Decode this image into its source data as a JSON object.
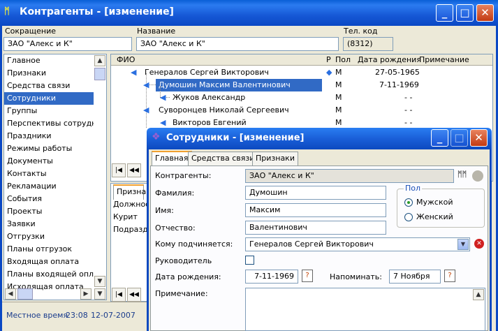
{
  "window": {
    "title": "Контрагенты - [изменение]"
  },
  "header": {
    "short_label": "Сокращение",
    "short_value": "ЗАО \"Алекс и К\"",
    "name_label": "Название",
    "name_value": "ЗАО \"Алекс и К\"",
    "phone_label": "Тел. код",
    "phone_value": "(8312)"
  },
  "sidebar": {
    "items": [
      "Главное",
      "Признаки",
      "Средства связи",
      "Сотрудники",
      "Группы",
      "Перспективы сотрудничества",
      "Праздники",
      "Режимы работы",
      "Документы",
      "Контакты",
      "Рекламации",
      "События",
      "Проекты",
      "Заявки",
      "Отгрузки",
      "Планы отгрузок",
      "Входящая оплата",
      "Планы входящей оплаты",
      "Исходящая оплата"
    ],
    "selected": "Сотрудники"
  },
  "grid": {
    "columns": {
      "fio": "ФИО",
      "flag": "Р",
      "gender": "Пол",
      "birth": "Дата рождения",
      "note": "Примечание"
    },
    "rows": [
      {
        "name": "Генералов Сергей Викторович",
        "gender": "М",
        "birth": "27-05-1965"
      },
      {
        "name": "Думошин Максим Валентинович",
        "gender": "М",
        "birth": "7-11-1969"
      },
      {
        "name": "Жуков Александр",
        "gender": "М",
        "birth": "- -"
      },
      {
        "name": "Суворонцев Николай Сергеевич",
        "gender": "М",
        "birth": "- -"
      },
      {
        "name": "Викторов Евгений",
        "gender": "М",
        "birth": "- -"
      }
    ]
  },
  "lower": {
    "tab": "Призна",
    "rows": [
      "Должност",
      "Курит",
      "Подразде"
    ]
  },
  "status": {
    "label": "Местное время",
    "time": "23:08",
    "date": "12-07-2007"
  },
  "dialog": {
    "title": "Сотрудники - [изменение]",
    "tabs": [
      "Главная",
      "Средства связи",
      "Признаки"
    ],
    "contractor_label": "Контрагенты:",
    "contractor_value": "ЗАО \"Алекс и К\"",
    "last_label": "Фамилия:",
    "last_value": "Думошин",
    "first_label": "Имя:",
    "first_value": "Максим",
    "middle_label": "Отчество:",
    "middle_value": "Валентинович",
    "boss_label": "Кому подчиняется:",
    "boss_value": "Генералов Сергей Викторович",
    "manager_label": "Руководитель",
    "birth_label": "Дата рождения:",
    "birth_value": "7-11-1969",
    "remind_label": "Напоминать:",
    "remind_value": "7 Ноября",
    "note_label": "Примечание:",
    "gender_group": "Пол",
    "male": "Мужской",
    "female": "Женский",
    "gender_selected": "Мужской"
  }
}
